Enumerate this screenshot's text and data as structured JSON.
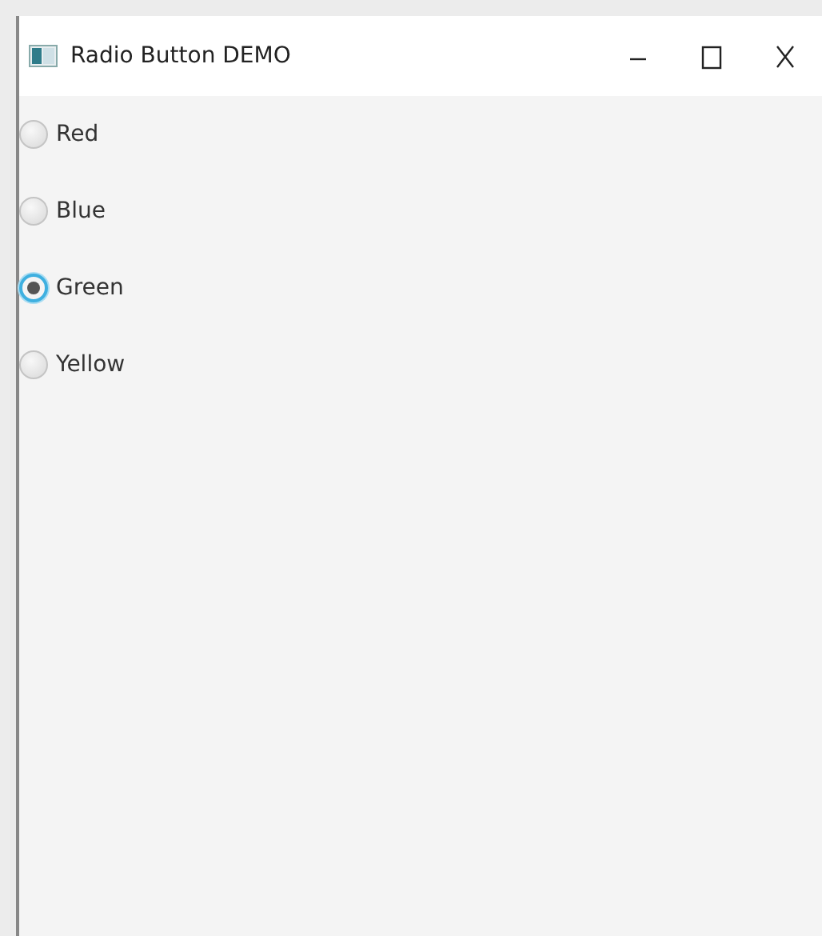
{
  "window": {
    "title": "Radio Button DEMO"
  },
  "radios": [
    {
      "label": "Red",
      "selected": false
    },
    {
      "label": "Blue",
      "selected": false
    },
    {
      "label": "Green",
      "selected": true
    },
    {
      "label": "Yellow",
      "selected": false
    }
  ]
}
